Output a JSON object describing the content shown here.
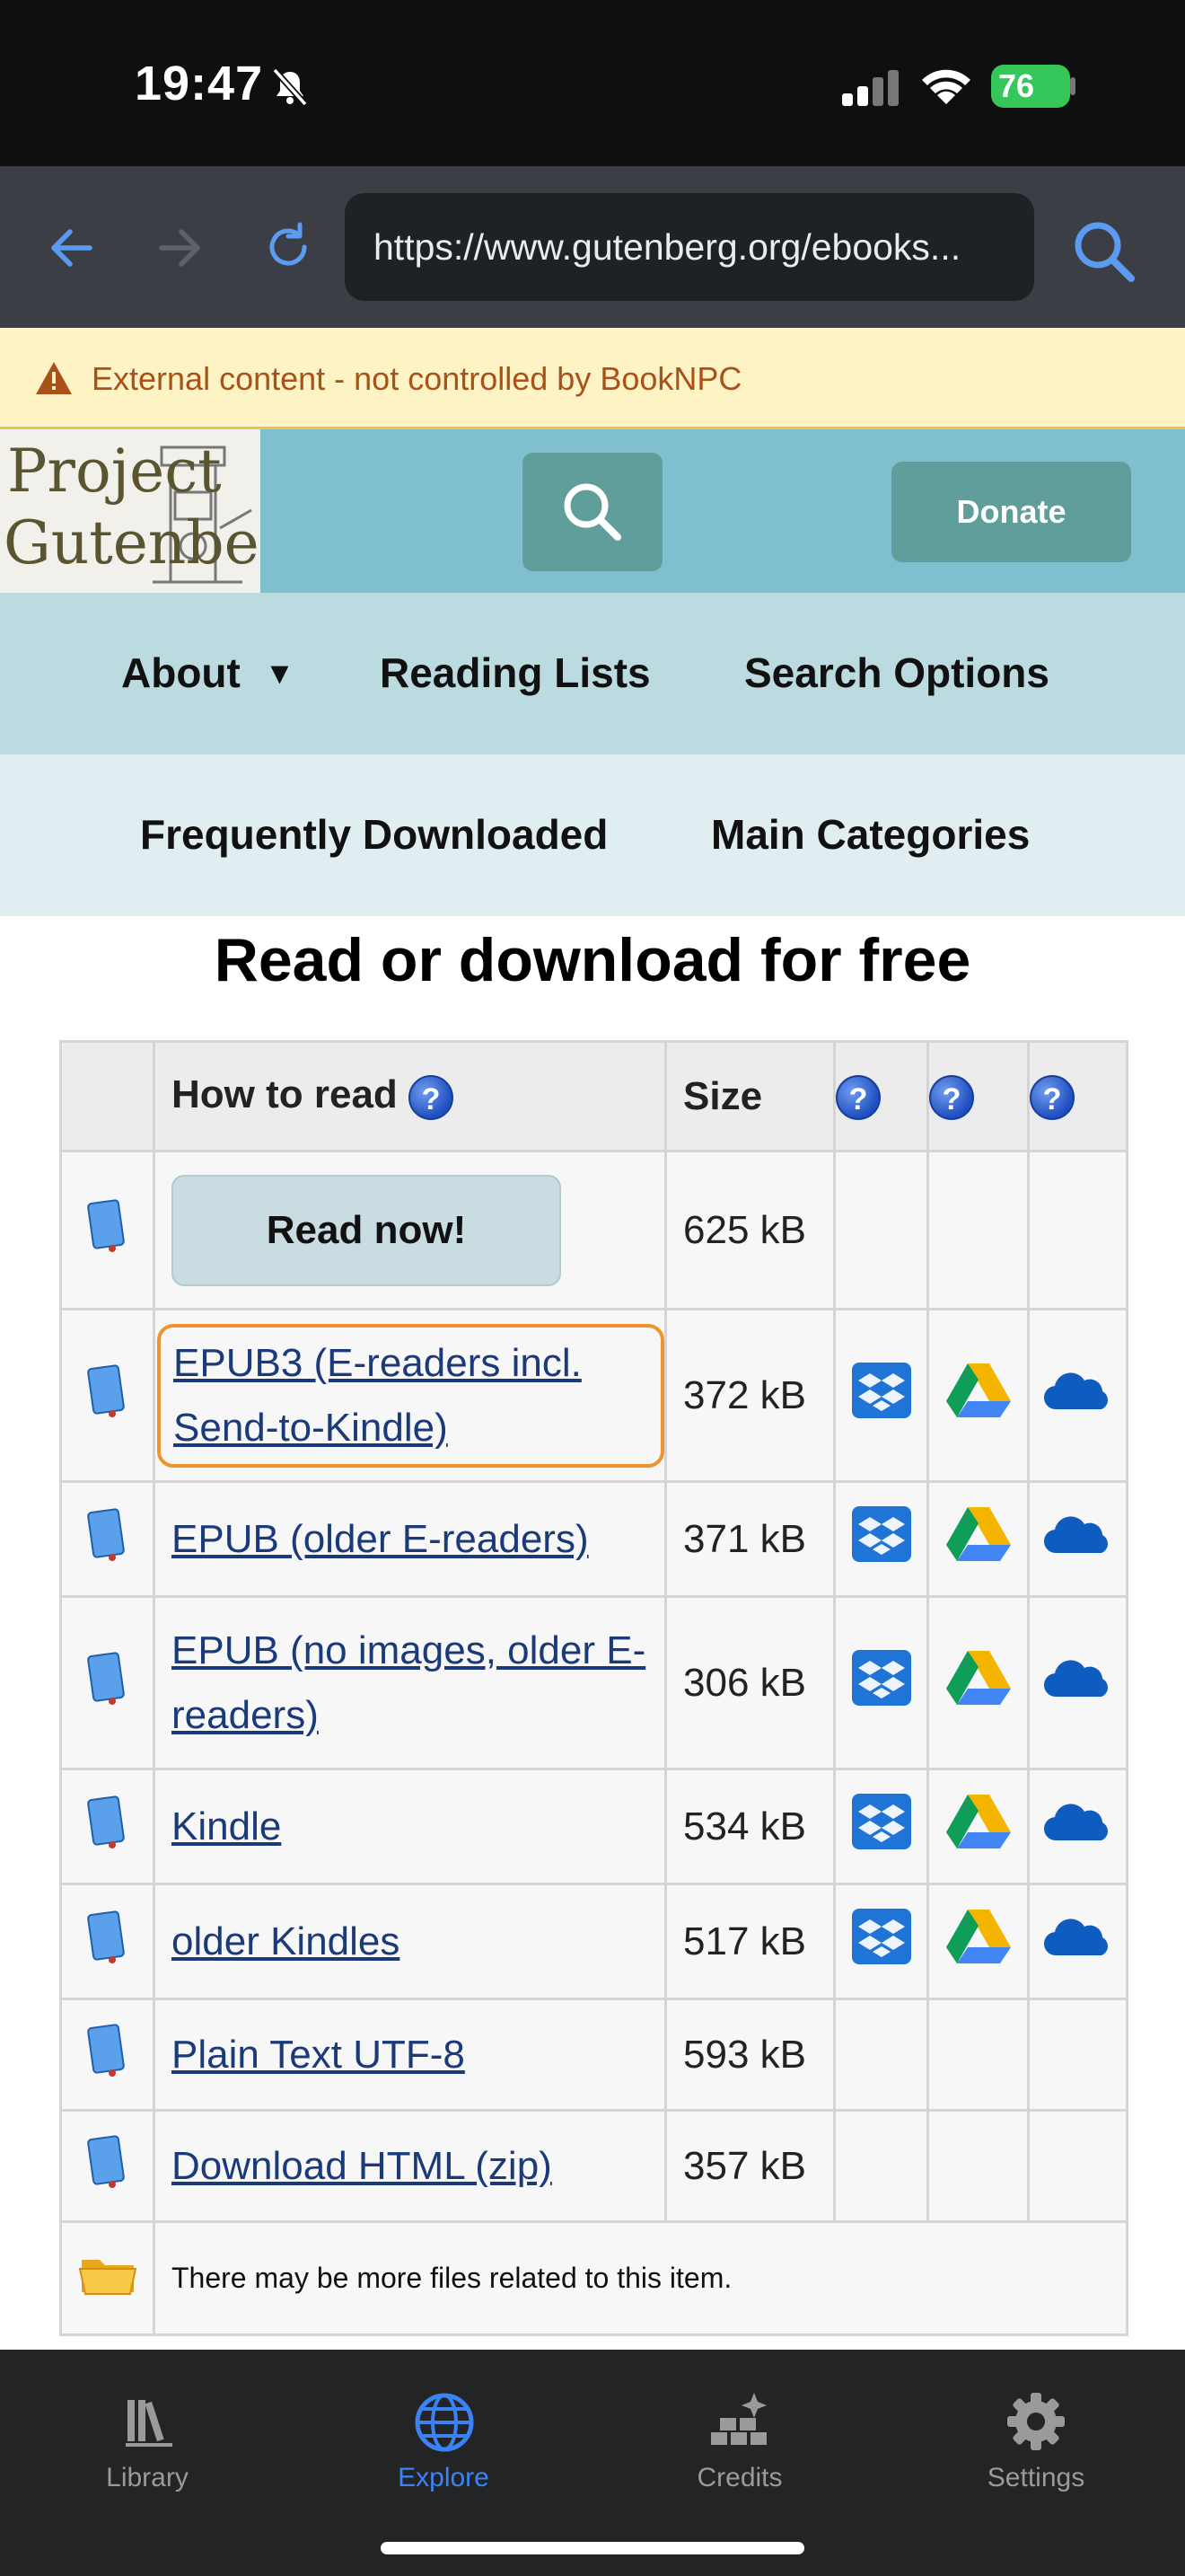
{
  "status_bar": {
    "time": "19:47",
    "battery": "76"
  },
  "browser": {
    "url": "https://www.gutenberg.org/ebooks...",
    "back_icon": "arrow-left-icon",
    "forward_icon": "arrow-right-icon",
    "reload_icon": "reload-icon",
    "search_icon": "search-icon"
  },
  "banner": {
    "text": "External content - not controlled by BookNPC",
    "icon": "warning-icon"
  },
  "site": {
    "logo_line1": "Project",
    "logo_line2": "Gutenberg",
    "donate_label": "Donate"
  },
  "nav": {
    "about": "About",
    "about_caret": "▼",
    "reading_lists": "Reading Lists",
    "search_options": "Search Options",
    "frequently_downloaded": "Frequently Downloaded",
    "main_categories": "Main Categories"
  },
  "heading": "Read or download for free",
  "table": {
    "headers": {
      "how_to_read": "How to read",
      "size": "Size",
      "help": "?"
    },
    "rows": [
      {
        "label": "Read now!",
        "size": "625 kB",
        "type": "button",
        "cloud": false
      },
      {
        "label": "EPUB3 (E-readers incl. Send-to-Kindle)",
        "size": "372 kB",
        "type": "link",
        "cloud": true,
        "focused": true
      },
      {
        "label": "EPUB (older E-readers)",
        "size": "371 kB",
        "type": "link",
        "cloud": true
      },
      {
        "label": "EPUB (no images, older E-readers)",
        "size": "306 kB",
        "type": "link",
        "cloud": true
      },
      {
        "label": "Kindle",
        "size": "534 kB",
        "type": "link",
        "cloud": true
      },
      {
        "label": "older Kindles",
        "size": "517 kB",
        "type": "link",
        "cloud": true
      },
      {
        "label": "Plain Text UTF-8",
        "size": "593 kB",
        "type": "link",
        "cloud": false
      },
      {
        "label": "Download HTML (zip)",
        "size": "357 kB",
        "type": "link",
        "cloud": false
      }
    ],
    "footer_note": "There may be more files related to this item."
  },
  "tabbar": {
    "tabs": [
      {
        "label": "Library",
        "icon": "library-icon",
        "active": false
      },
      {
        "label": "Explore",
        "icon": "globe-icon",
        "active": true
      },
      {
        "label": "Credits",
        "icon": "credits-icon",
        "active": false
      },
      {
        "label": "Settings",
        "icon": "gear-icon",
        "active": false
      }
    ]
  },
  "colors": {
    "accent": "#3b82f6",
    "link": "#1a3a7a",
    "focus_ring": "#f0922e",
    "banner_bg": "#fdf3c4"
  }
}
